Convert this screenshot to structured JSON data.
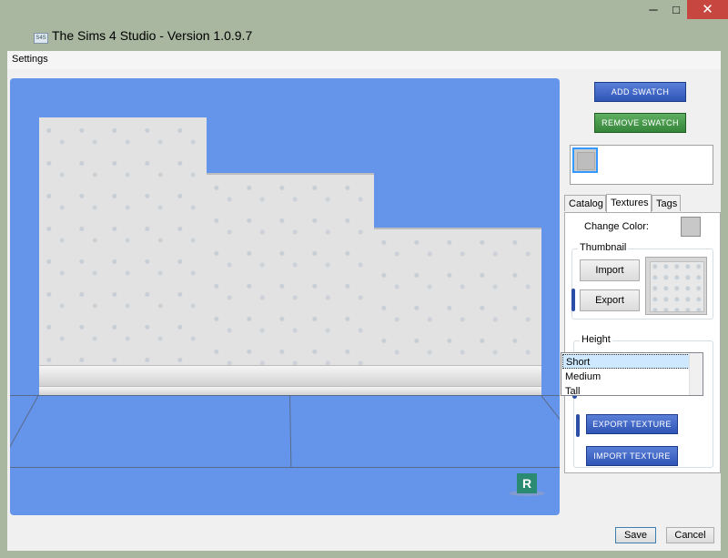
{
  "window": {
    "title": "The Sims 4 Studio - Version 1.0.9.7",
    "app_icon_text": "S4S",
    "controls": {
      "minimize": "─",
      "maximize": "□",
      "close": "✕"
    }
  },
  "menu": {
    "settings_label": "Settings"
  },
  "viewport": {
    "corner_badge": "R"
  },
  "panel": {
    "add_swatch_label": "ADD SWATCH",
    "remove_swatch_label": "REMOVE SWATCH",
    "tabs": [
      {
        "label": "Catalog",
        "active": false
      },
      {
        "label": "Textures",
        "active": true
      },
      {
        "label": "Tags",
        "active": false
      }
    ],
    "change_color_label": "Change Color:",
    "thumbnail": {
      "group_title": "Thumbnail",
      "import_label": "Import",
      "export_label": "Export"
    },
    "height": {
      "group_title": "Height",
      "options": [
        "Short",
        "Medium",
        "Tall"
      ],
      "selected": "Short"
    },
    "export_texture_label": "EXPORT TEXTURE",
    "import_texture_label": "IMPORT TEXTURE"
  },
  "footer": {
    "save_label": "Save",
    "cancel_label": "Cancel"
  },
  "colors": {
    "viewport_blue": "#6595ea",
    "button_blue": "#2f55b6",
    "button_green": "#35843a",
    "close_red": "#c7463f",
    "window_frame": "#a9b7a0"
  }
}
